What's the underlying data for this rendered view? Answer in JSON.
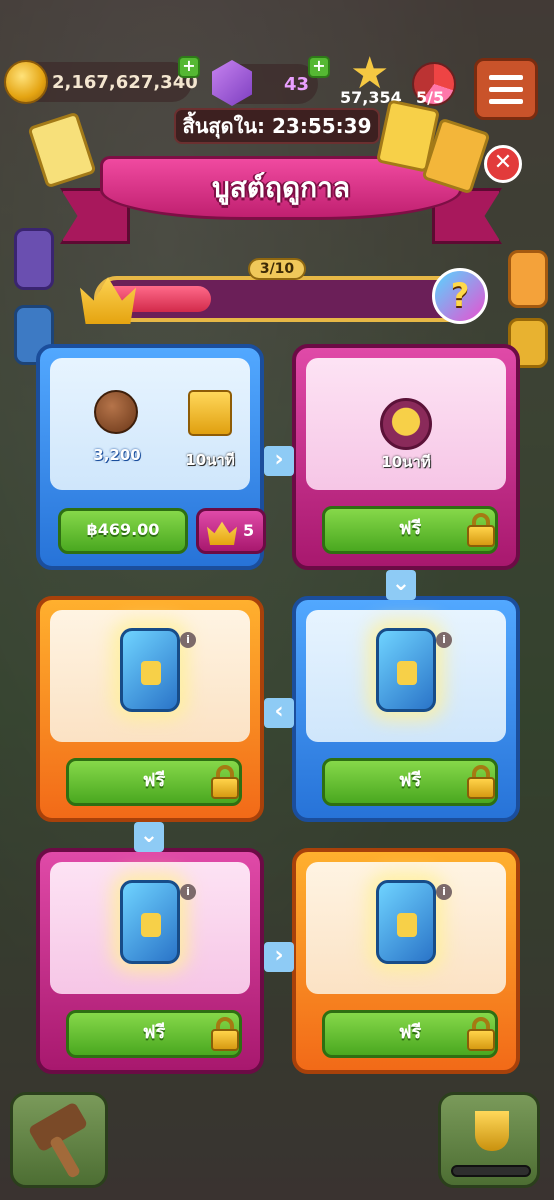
{
  "hud": {
    "coins": "2,167,627,340",
    "gems": "43",
    "stars": "57,354",
    "lives": "5/5",
    "coin_icon": "coin-icon",
    "gem_icon": "gem-icon",
    "star_icon": "star-icon",
    "menu_icon": "menu-icon"
  },
  "event": {
    "timer": "สิ้นสุดใน: 23:55:39",
    "title": "บูสต์ฤดูกาล",
    "progress_label": "3/10",
    "progress": 0.3
  },
  "tiles": [
    {
      "color": "blue",
      "rewards": [
        {
          "icon": "boost-icon",
          "value": "3,200"
        },
        {
          "icon": "crown-card-icon",
          "value": "10นาที"
        }
      ],
      "price": "฿469.00",
      "crown_cost": "5"
    },
    {
      "color": "pink",
      "reward": {
        "icon": "star-gift-icon",
        "value": "10นาที"
      },
      "button": "ฟรี",
      "locked": true
    },
    {
      "color": "orange",
      "reward": {
        "icon": "chest-icon"
      },
      "button": "ฟรี",
      "locked": true
    },
    {
      "color": "blue",
      "reward": {
        "icon": "chest-icon"
      },
      "button": "ฟรี",
      "locked": true
    },
    {
      "color": "pink",
      "reward": {
        "icon": "chest-icon"
      },
      "button": "ฟรี",
      "locked": true
    },
    {
      "color": "orange",
      "reward": {
        "icon": "chest-icon"
      },
      "button": "ฟรี",
      "locked": true
    }
  ],
  "connectors": [
    "›",
    "⌄",
    "‹",
    "⌄",
    "›"
  ],
  "info_glyph": "i",
  "close_glyph": "✕",
  "mystery_glyph": "?",
  "colors": {
    "blue": "#2773d8",
    "pink": "#a8186e",
    "orange": "#f26a18",
    "green_button": "#4aa820",
    "banner": "#c02070"
  }
}
